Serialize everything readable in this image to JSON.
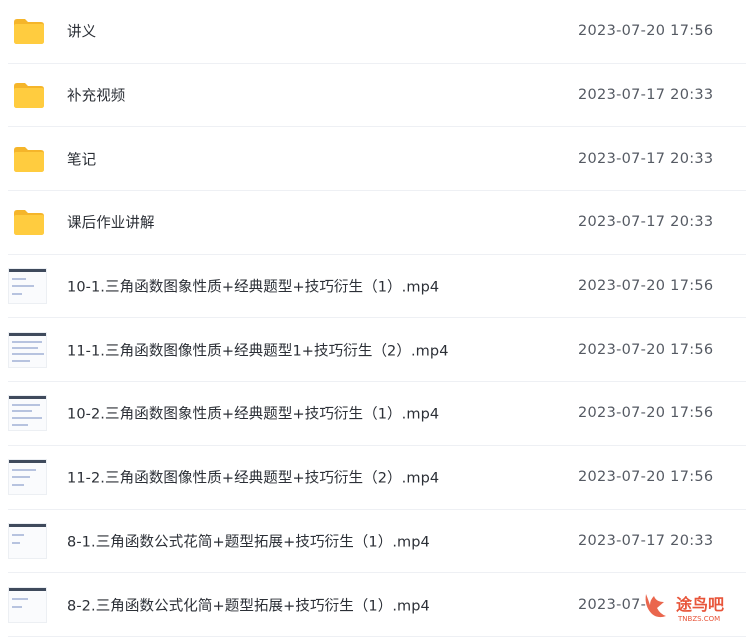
{
  "files": [
    {
      "name": "讲义",
      "date": "2023-07-20 17:56",
      "type": "folder",
      "icon": "folder-icon"
    },
    {
      "name": "补充视频",
      "date": "2023-07-17 20:33",
      "type": "folder",
      "icon": "folder-icon"
    },
    {
      "name": "笔记",
      "date": "2023-07-17 20:33",
      "type": "folder",
      "icon": "folder-icon"
    },
    {
      "name": "课后作业讲解",
      "date": "2023-07-17 20:33",
      "type": "folder",
      "icon": "folder-icon"
    },
    {
      "name": "10-1.三角函数图象性质+经典题型+技巧衍生（1）.mp4",
      "date": "2023-07-20 17:56",
      "type": "video",
      "icon": "video-thumbnail"
    },
    {
      "name": "11-1.三角函数图像性质+经典题型1+技巧衍生（2）.mp4",
      "date": "2023-07-20 17:56",
      "type": "video",
      "icon": "video-thumbnail"
    },
    {
      "name": "10-2.三角函数图象性质+经典题型+技巧衍生（1）.mp4",
      "date": "2023-07-20 17:56",
      "type": "video",
      "icon": "video-thumbnail"
    },
    {
      "name": "11-2.三角函数图像性质+经典题型+技巧衍生（2）.mp4",
      "date": "2023-07-20 17:56",
      "type": "video",
      "icon": "video-thumbnail"
    },
    {
      "name": "8-1.三角函数公式花简+题型拓展+技巧衍生（1）.mp4",
      "date": "2023-07-17 20:33",
      "type": "video",
      "icon": "video-thumbnail"
    },
    {
      "name": "8-2.三角函数公式化简+题型拓展+技巧衍生（1）.mp4",
      "date": "2023-07-",
      "type": "video",
      "icon": "video-thumbnail"
    }
  ],
  "watermark": {
    "text": "途鸟吧",
    "subtext": "TNBZS.COM",
    "color": "#e8553a"
  },
  "colors": {
    "folder": "#f7c342",
    "folder_back": "#f5b52a"
  }
}
